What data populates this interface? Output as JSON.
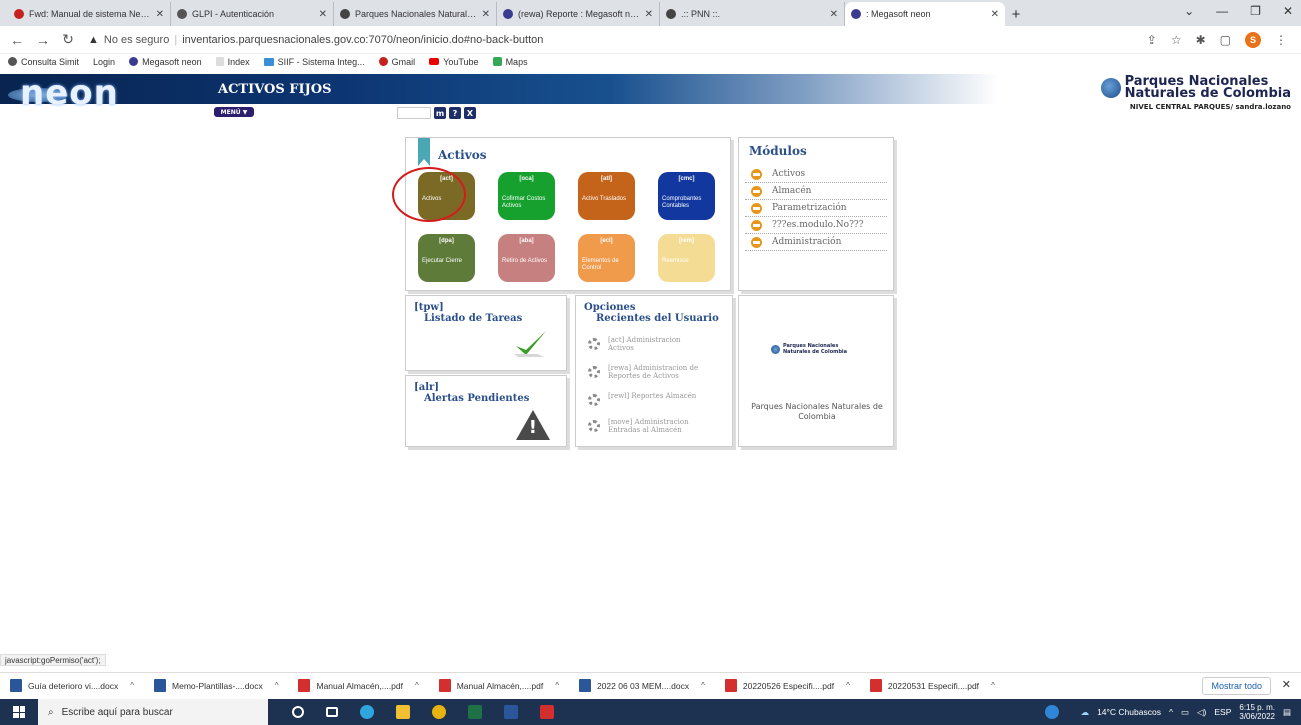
{
  "browser": {
    "tabs": [
      {
        "label": "Fwd: Manual de sistema Neon. -",
        "color": "#c5221f"
      },
      {
        "label": "GLPI - Autenticación",
        "color": "#555555"
      },
      {
        "label": "Parques Nacionales Naturales de",
        "color": "#444444"
      },
      {
        "label": "(rewa) Reporte : Megasoft neon",
        "color": "#3b3b8f"
      },
      {
        "label": ".:: PNN ::.",
        "color": "#444444"
      },
      {
        "label": ": Megasoft neon",
        "color": "#3b3b8f",
        "active": true
      }
    ],
    "address": {
      "security": "No es seguro",
      "url": "inventarios.parquesnacionales.gov.co:7070/neon/inicio.do#no-back-button"
    },
    "profile_initial": "S",
    "bookmarks": [
      "Consulta Simit",
      "Login",
      "Megasoft neon",
      "Index",
      "SIIF - Sistema Integ...",
      "Gmail",
      "YouTube",
      "Maps"
    ]
  },
  "header": {
    "logo": "neon",
    "title": "ACTIVOS FIJOS",
    "menu_label": "MENÚ ▼",
    "tool_buttons": [
      "m",
      "?",
      "X"
    ],
    "brand_line1": "Parques Nacionales",
    "brand_line2": "Naturales de Colombia",
    "user": "NIVEL CENTRAL PARQUES/ sandra.lozano"
  },
  "activos": {
    "title": "Activos",
    "tiles": [
      {
        "code": "[act]",
        "label": "Activos",
        "color": "#7a6a26"
      },
      {
        "code": "[oca]",
        "label": "Cofirmar Costos Activos",
        "color": "#16a12f"
      },
      {
        "code": "[atl]",
        "label": "Activo Traslados",
        "color": "#c4641a"
      },
      {
        "code": "[cmc]",
        "label": "Comprobantes Contables",
        "color": "#1238a0"
      },
      {
        "code": "[dpa]",
        "label": "Ejecutar Cierre",
        "color": "#5f7b3a"
      },
      {
        "code": "[aba]",
        "label": "Retiro de Activos",
        "color": "#c6807f"
      },
      {
        "code": "[ecl]",
        "label": "Elementos de Control",
        "color": "#f09a4c"
      },
      {
        "code": "[rem]",
        "label": "Reemisos",
        "color": "#f5dc94"
      }
    ]
  },
  "modulos": {
    "title": "Módulos",
    "items": [
      "Activos",
      "Almacén",
      "Parametrización",
      "???es.modulo.No???",
      "Administración"
    ]
  },
  "tareas": {
    "code": "[tpw]",
    "title": "Listado de Tareas"
  },
  "alertas": {
    "code": "[alr]",
    "title": "Alertas Pendientes"
  },
  "opciones": {
    "title1": "Opciones",
    "title2": "Recientes del Usuario",
    "items": [
      {
        "line1": "[act] Administracion",
        "line2": "Activos"
      },
      {
        "line1": "[rewa] Administracion de",
        "line2": "Reportes de Activos"
      },
      {
        "line1": "[rewl] Reportes Almacén",
        "line2": ""
      },
      {
        "line1": "[move] Administracion",
        "line2": "Entradas al Almacén"
      }
    ]
  },
  "parques_panel": {
    "logo_line1": "Parques Nacionales",
    "logo_line2": "Naturales de Colombia",
    "text": "Parques Nacionales Naturales de Colombia"
  },
  "status_text": "javascript:goPermiso('act');",
  "downloads": {
    "items": [
      {
        "name": "Guía deterioro vi....docx",
        "color": "#2b579a"
      },
      {
        "name": "Memo-Plantillas-....docx",
        "color": "#2b579a"
      },
      {
        "name": "Manual Almacén,....pdf",
        "color": "#d32f2f"
      },
      {
        "name": "Manual Almacén,....pdf",
        "color": "#d32f2f"
      },
      {
        "name": "2022 06 03 MEM....docx",
        "color": "#2b579a"
      },
      {
        "name": "20220526 Especifi....pdf",
        "color": "#d32f2f"
      },
      {
        "name": "20220531 Especifi....pdf",
        "color": "#d32f2f"
      }
    ],
    "show_all": "Mostrar todo"
  },
  "taskbar": {
    "search_placeholder": "Escribe aquí para buscar",
    "weather": "14°C Chubascos",
    "lang": "ESP",
    "time": "6:15 p. m.",
    "date": "3/06/2022"
  }
}
